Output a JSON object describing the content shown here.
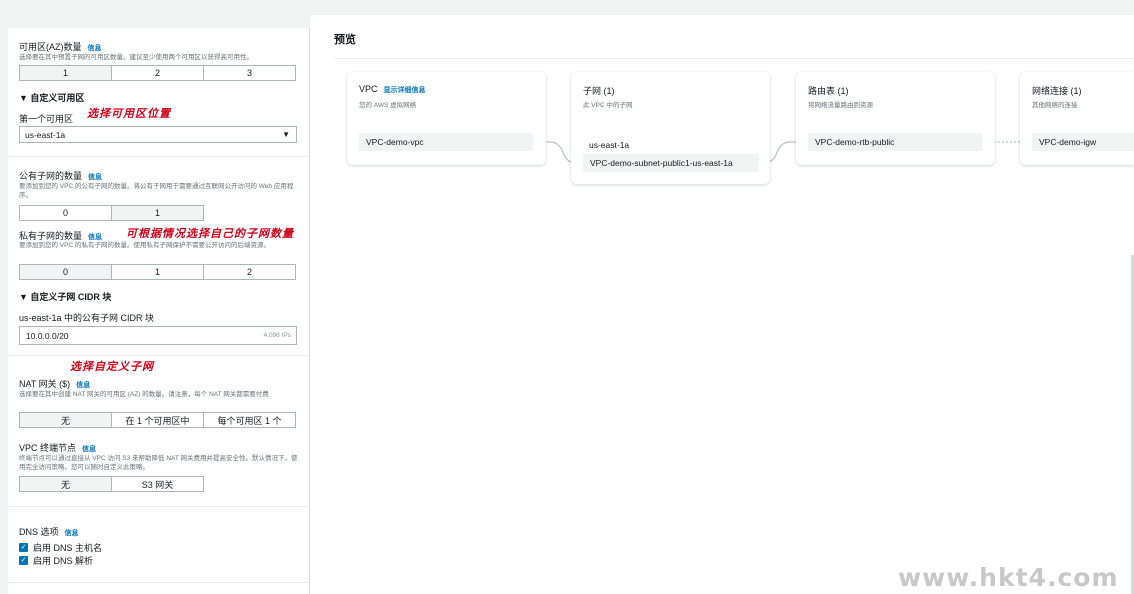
{
  "az_count": {
    "label": "可用区(AZ)数量",
    "info": "信息",
    "description": "选择要在其中预置子网的可用区数量。建议至少使用两个可用区以获得高可用性。",
    "options": [
      "1",
      "2",
      "3"
    ],
    "selected": "1"
  },
  "custom_az": {
    "toggle": "▼ 自定义可用区",
    "first_az_label": "第一个可用区",
    "first_az_value": "us-east-1a",
    "annotation": "选择可用区位置"
  },
  "public_subnets": {
    "label": "公有子网的数量",
    "info": "信息",
    "description": "要添加到您的 VPC 的公有子网的数量。将公有子网用于需要通过互联网公开访问的 Web 应用程序。",
    "options": [
      "0",
      "1"
    ],
    "selected": "1"
  },
  "private_subnets": {
    "label": "私有子网的数量",
    "info": "信息",
    "description": "要添加到您的 VPC 的私有子网的数量。使用私有子网保护不需要公开访问的后端资源。",
    "options": [
      "0",
      "1",
      "2"
    ],
    "selected": "0",
    "annotation": "可根据情况选择自己的子网数量"
  },
  "custom_cidr": {
    "toggle": "▼ 自定义子网 CIDR 块",
    "field_label": "us-east-1a 中的公有子网 CIDR 块",
    "value": "10.0.0.0/20",
    "suffix": "4,096 IPs",
    "annotation": "选择自定义子网"
  },
  "nat_gateway": {
    "label": "NAT 网关 ($)",
    "info": "信息",
    "description": "选择要在其中创建 NAT 网关的可用区 (AZ) 的数量。请注意，每个 NAT 网关都需要付费",
    "options": [
      "无",
      "在 1 个可用区中",
      "每个可用区 1 个"
    ],
    "selected": "无"
  },
  "vpc_endpoints": {
    "label": "VPC 终端节点",
    "info": "信息",
    "description": "终端节点可以通过直接从 VPC 访问 S3 来帮助降低 NAT 网关费用并提高安全性。默认情况下，使用完全访问策略。您可以随时自定义此策略。",
    "options": [
      "无",
      "S3 网关"
    ],
    "selected": "无"
  },
  "dns": {
    "label": "DNS 选项",
    "info": "信息",
    "hostnames": "启用 DNS 主机名",
    "resolution": "启用 DNS 解析"
  },
  "preview": {
    "title": "预览",
    "vpc": {
      "title": "VPC",
      "detail_link": "显示详细信息",
      "subtitle": "您的 AWS 虚拟网络",
      "resource": "VPC-demo-vpc"
    },
    "subnets": {
      "title": "子网 (1)",
      "subtitle": "此 VPC 中的子网",
      "az": "us-east-1a",
      "resource": "VPC-demo-subnet-public1-us-east-1a"
    },
    "route_tables": {
      "title": "路由表 (1)",
      "subtitle": "将网络流量路由到资源",
      "resource": "VPC-demo-rtb-public"
    },
    "network_connections": {
      "title": "网络连接 (1)",
      "subtitle": "其他网络的连接",
      "resource": "VPC-demo-igw"
    }
  },
  "watermark": "www.hkt4.com",
  "colors": {
    "link": "#0073bb",
    "annotation": "#d0021b",
    "selected_option": "#f2f3f3",
    "border": "#aab7b8"
  }
}
